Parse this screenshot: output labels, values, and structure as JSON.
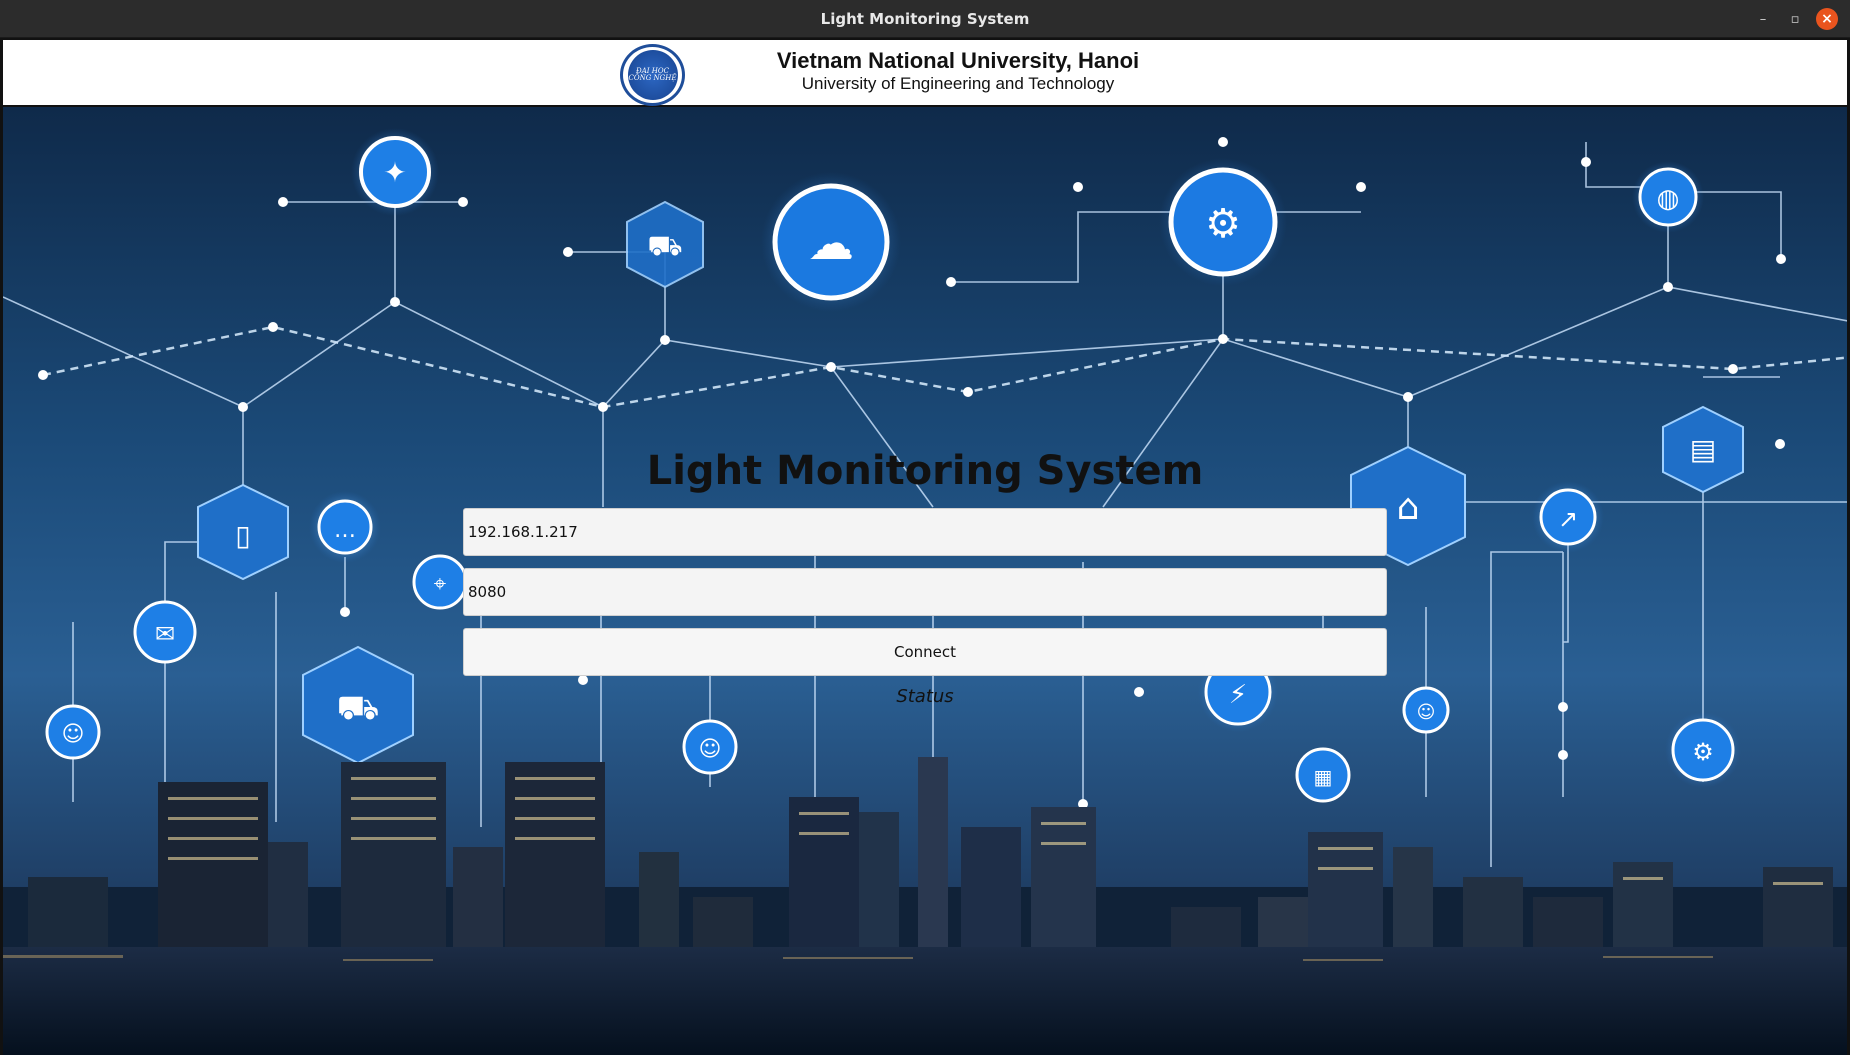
{
  "window": {
    "title": "Light Monitoring System",
    "controls": {
      "minimize": "–",
      "maximize": "▫",
      "close": "×"
    }
  },
  "header": {
    "logo_text": "ĐẠI HỌC CÔNG NGHỆ",
    "university_name": "Vietnam National University, Hanoi",
    "university_subtitle": "University of Engineering and Technology"
  },
  "main": {
    "app_title": "Light Monitoring System",
    "ip_field": {
      "value": "192.168.1.217"
    },
    "port_field": {
      "value": "8080"
    },
    "connect_label": "Connect",
    "status_text": "Status"
  },
  "colors": {
    "sky_top": "#0f2a4a",
    "node_glow": "#4aa8ff",
    "close_button": "#e9541e"
  }
}
